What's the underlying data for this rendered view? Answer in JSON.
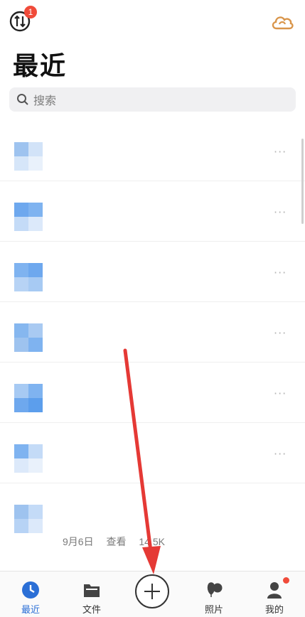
{
  "header": {
    "transfer_badge": "1",
    "page_title": "最近"
  },
  "search": {
    "placeholder": "搜索"
  },
  "files": [
    {
      "name": "",
      "date": "",
      "action": "",
      "size": ""
    },
    {
      "name": "",
      "date": "",
      "action": "",
      "size": ""
    },
    {
      "name": "",
      "date": "",
      "action": "",
      "size": ""
    },
    {
      "name": "",
      "date": "",
      "action": "",
      "size": ""
    },
    {
      "name": "",
      "date": "",
      "action": "",
      "size": ""
    },
    {
      "name": "",
      "date": "",
      "action": "",
      "size": ""
    },
    {
      "name": "",
      "date": "9月6日",
      "action": "查看",
      "size": "14.5K"
    }
  ],
  "more_glyph": "···",
  "tabs": [
    {
      "label": "最近",
      "icon": "clock-icon",
      "active": true
    },
    {
      "label": "文件",
      "icon": "folder-icon",
      "active": false
    },
    {
      "label": "",
      "icon": "plus-icon",
      "active": false
    },
    {
      "label": "照片",
      "icon": "photo-balloon-icon",
      "active": false
    },
    {
      "label": "我的",
      "icon": "person-icon",
      "active": false
    }
  ],
  "colors": {
    "accent": "#2b6fd6",
    "badge": "#f04b3a",
    "cloud": "#d9954a",
    "annotation_arrow": "#e53935"
  }
}
